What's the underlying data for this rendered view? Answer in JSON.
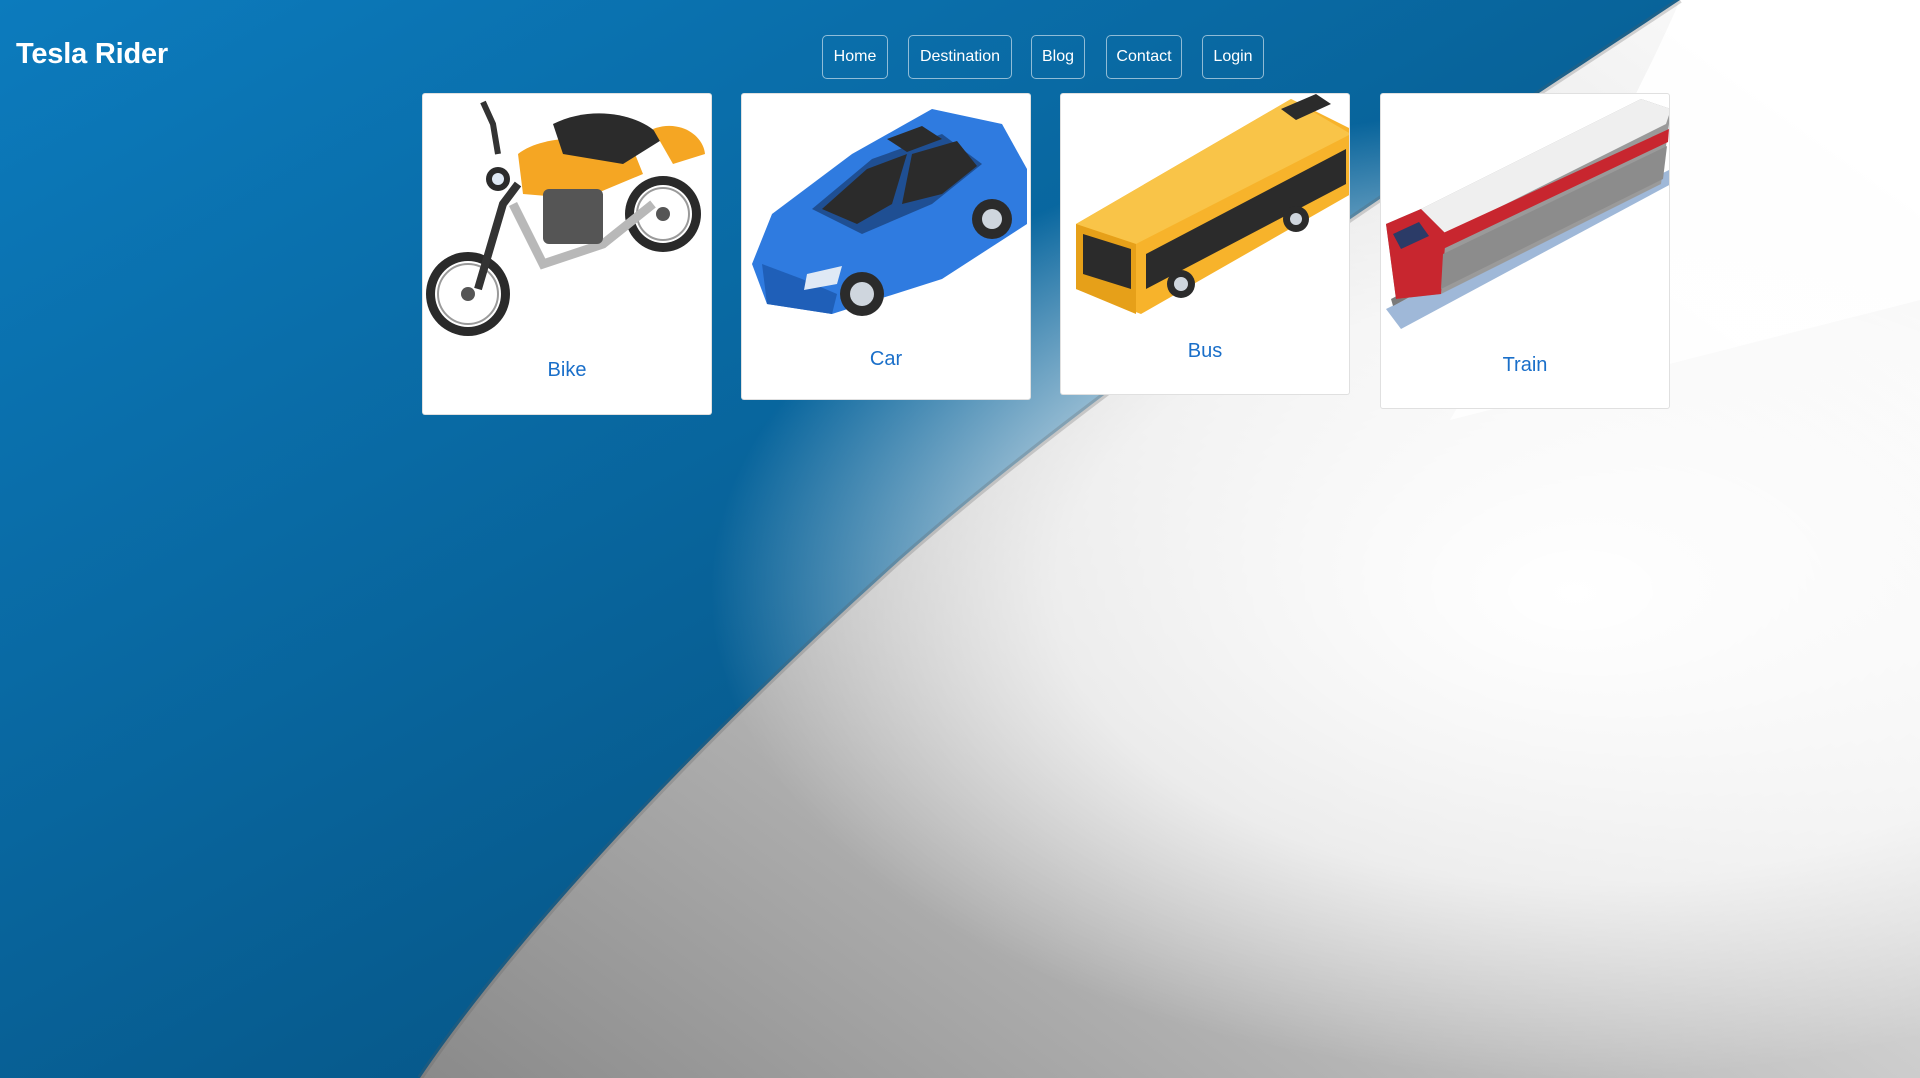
{
  "brand": {
    "name": "Tesla Rider"
  },
  "nav": {
    "items": [
      {
        "label": "Home"
      },
      {
        "label": "Destination"
      },
      {
        "label": "Blog"
      },
      {
        "label": "Contact"
      },
      {
        "label": "Login"
      }
    ]
  },
  "vehicles": [
    {
      "title": "Bike",
      "icon": "motorcycle-icon"
    },
    {
      "title": "Car",
      "icon": "car-icon"
    },
    {
      "title": "Bus",
      "icon": "bus-icon"
    },
    {
      "title": "Train",
      "icon": "train-icon"
    }
  ],
  "colors": {
    "background_blue": "#0a5f94",
    "card_title": "#1a6fc9",
    "card_background": "#ffffff"
  }
}
